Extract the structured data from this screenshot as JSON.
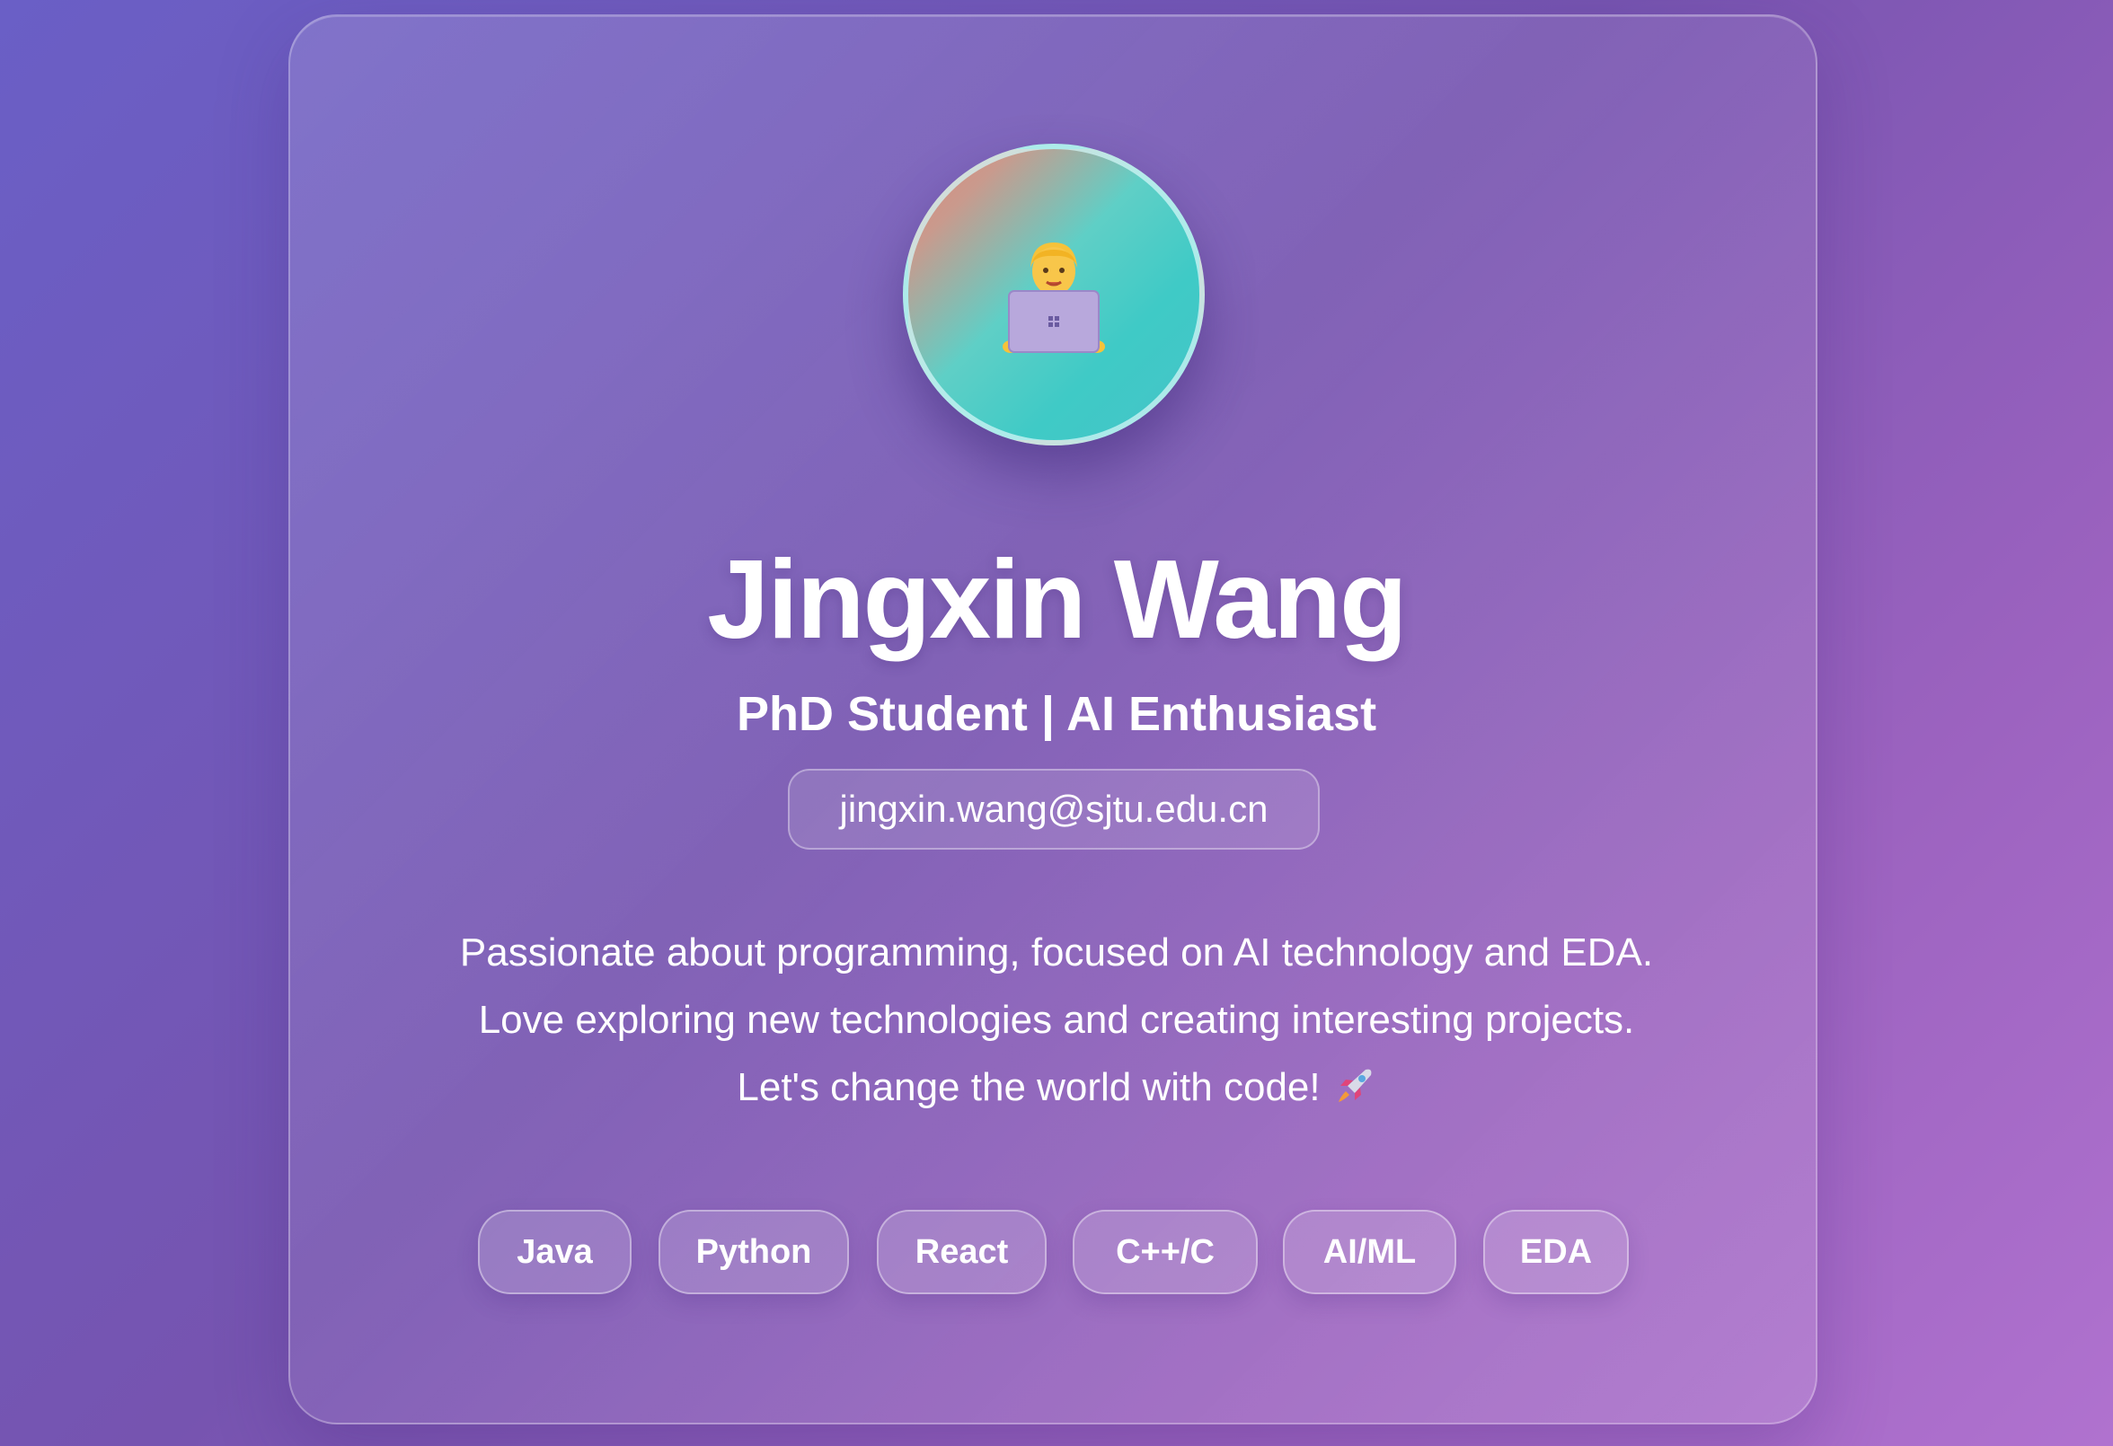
{
  "profile": {
    "name": "Jingxin Wang",
    "subtitle": "PhD Student | AI Enthusiast",
    "email": "jingxin.wang@sjtu.edu.cn",
    "avatar_icon": "technologist-emoji-icon",
    "bio": [
      "Passionate about programming, focused on AI technology and EDA.",
      "Love exploring new technologies and creating interesting projects.",
      "Let's change the world with code!"
    ],
    "bio_end_icon": "rocket-icon"
  },
  "tags": [
    "Java",
    "Python",
    "React",
    "C++/C",
    "AI/ML",
    "EDA"
  ],
  "colors": {
    "background_start": "#6a5fc6",
    "background_end": "#b072cf",
    "avatar_teal": "#3fcac6",
    "avatar_coral": "#e0867a",
    "text": "#ffffff"
  }
}
